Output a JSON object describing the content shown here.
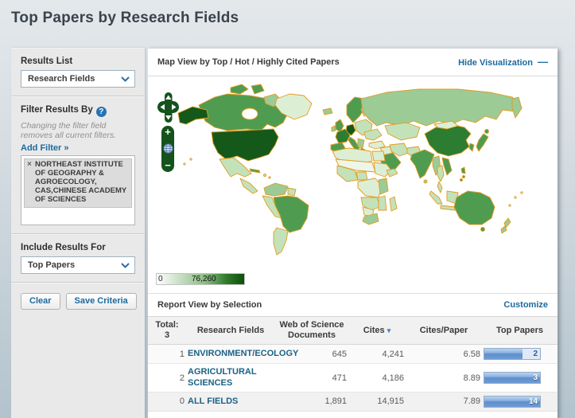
{
  "page": {
    "title": "Top Papers by Research Fields"
  },
  "sidebar": {
    "results_list_label": "Results List",
    "results_list_value": "Research Fields",
    "filter_label": "Filter Results By",
    "filter_help": "?",
    "filter_note": "Changing the filter field removes all current filters.",
    "add_filter_link": "Add Filter »",
    "filter_tag_remove": "×",
    "filter_tag_text": "NORTHEAST INSTITUTE OF GEOGRAPHY & AGROECOLOGY, CAS,CHINESE ACADEMY OF SCIENCES",
    "include_label": "Include Results For",
    "include_value": "Top Papers",
    "clear_button": "Clear",
    "save_button": "Save Criteria"
  },
  "map": {
    "title": "Map View by Top / Hot / Highly Cited Papers",
    "hide_link": "Hide Visualization",
    "collapse_glyph": "—",
    "zoom_in": "+",
    "zoom_out": "−",
    "legend_min": "0",
    "legend_max": "76,260"
  },
  "report": {
    "title": "Report View by Selection",
    "customize_link": "Customize",
    "total_label": "Total:",
    "total_value": "3",
    "columns": {
      "fields": "Research Fields",
      "documents": "Web of Science Documents",
      "cites": "Cites",
      "sort_glyph": "▾",
      "cites_per_paper": "Cites/Paper",
      "top_papers": "Top Papers"
    },
    "rows": [
      {
        "rank": "1",
        "field": "ENVIRONMENT/ECOLOGY",
        "documents": "645",
        "cites": "4,241",
        "cites_per_paper": "6.58",
        "top_papers": "2",
        "bar_percent": 68
      },
      {
        "rank": "2",
        "field": "AGRICULTURAL SCIENCES",
        "documents": "471",
        "cites": "4,186",
        "cites_per_paper": "8.89",
        "top_papers": "3",
        "bar_percent": 100
      },
      {
        "rank": "0",
        "field": "ALL FIELDS",
        "documents": "1,891",
        "cites": "14,915",
        "cites_per_paper": "7.89",
        "top_papers": "14",
        "bar_percent": 100
      }
    ]
  },
  "colors": {
    "accent_link": "#1c6a9e",
    "map_border": "#e39b1f",
    "map_palette": [
      "#eef6ea",
      "#dcefd5",
      "#c3e2ba",
      "#9ccb95",
      "#4f9c50",
      "#2c7c31",
      "#14591a"
    ],
    "legend_gradient_end": "#0d4f0d",
    "bar_blue": "#6e9cd4"
  }
}
